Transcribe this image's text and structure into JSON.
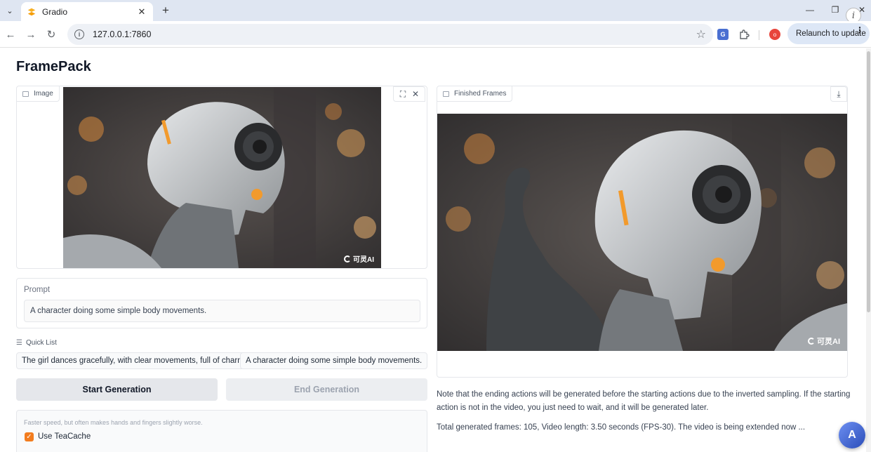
{
  "browser": {
    "tab_title": "Gradio",
    "tab_close": "✕",
    "new_tab": "+",
    "url": "127.0.0.1:7860",
    "relaunch_label": "Relaunch to update",
    "profile_initial": "o",
    "translate_glyph": "G",
    "info_glyph": "i"
  },
  "page": {
    "title": "FramePack"
  },
  "input_image": {
    "label": "Image",
    "watermark": "可灵AI"
  },
  "output_video": {
    "label": "Finished Frames",
    "watermark": "可灵AI"
  },
  "prompt": {
    "label": "Prompt",
    "value": "A character doing some simple body movements."
  },
  "quick_list": {
    "label": "Quick List",
    "items": [
      "The girl dances gracefully, with clear movements, full of charm.",
      "A character doing some simple body movements."
    ]
  },
  "buttons": {
    "start": "Start Generation",
    "end": "End Generation"
  },
  "teacache": {
    "hint": "Faster speed, but often makes hands and fingers slightly worse.",
    "label": "Use TeaCache",
    "checked": true
  },
  "notes": "Note that the ending actions will be generated before the starting actions due to the inverted sampling. If the starting action is not in the video, you just need to wait, and it will be generated later.",
  "status": "Total generated frames: 105, Video length: 3.50 seconds (FPS-30). The video is being extended now ...",
  "colors": {
    "accent": "#f27c1e",
    "chrome": "#dfe6f2"
  },
  "icons": {
    "fab": "A"
  }
}
